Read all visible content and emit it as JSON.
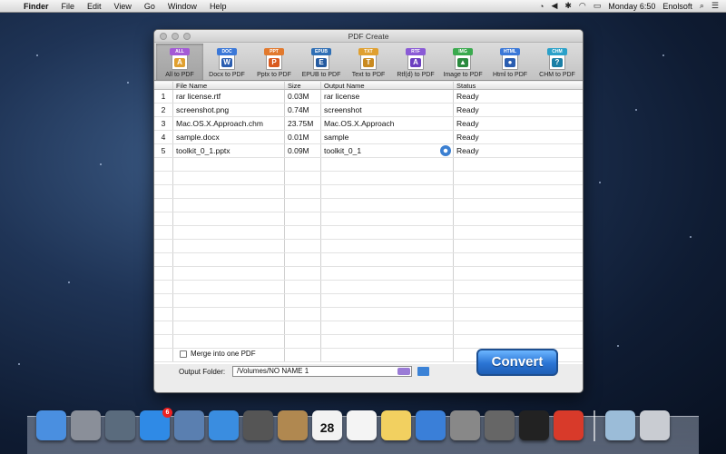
{
  "menubar": {
    "app": "Finder",
    "items": [
      "File",
      "Edit",
      "View",
      "Go",
      "Window",
      "Help"
    ],
    "clock": "Monday 6:50",
    "user": "Enolsoft"
  },
  "window": {
    "title": "PDF Create",
    "tools": [
      {
        "tag": "ALL",
        "label": "All to PDF",
        "tag_color": "#a45ad6",
        "sym_color": "#e0a030",
        "sym": "A"
      },
      {
        "tag": "DOC",
        "label": "Docx to PDF",
        "tag_color": "#3b78d8",
        "sym_color": "#2a5db0",
        "sym": "W"
      },
      {
        "tag": "PPT",
        "label": "Pptx to PDF",
        "tag_color": "#e2792d",
        "sym_color": "#d95a1e",
        "sym": "P"
      },
      {
        "tag": "EPUB",
        "label": "EPUB to PDF",
        "tag_color": "#2f6fb5",
        "sym_color": "#245aa0",
        "sym": "E"
      },
      {
        "tag": "TXT",
        "label": "Text to PDF",
        "tag_color": "#e0a030",
        "sym_color": "#c98a20",
        "sym": "T"
      },
      {
        "tag": "RTF",
        "label": "Rtf(d) to PDF",
        "tag_color": "#8a5ad6",
        "sym_color": "#6c3fc0",
        "sym": "A"
      },
      {
        "tag": "IMG",
        "label": "Image to PDF",
        "tag_color": "#3aaa4e",
        "sym_color": "#2a8a3e",
        "sym": "▲"
      },
      {
        "tag": "HTML",
        "label": "Html to PDF",
        "tag_color": "#3b78d8",
        "sym_color": "#2a5db0",
        "sym": "●"
      },
      {
        "tag": "CHM",
        "label": "CHM to PDF",
        "tag_color": "#2aa1c9",
        "sym_color": "#1a7fa6",
        "sym": "?"
      }
    ],
    "columns": [
      "",
      "File Name",
      "Size",
      "Output Name",
      "Status"
    ],
    "rows": [
      {
        "n": "1",
        "file": "rar license.rtf",
        "size": "0.03M",
        "out": "rar license",
        "status": "Ready"
      },
      {
        "n": "2",
        "file": "screenshot.png",
        "size": "0.74M",
        "out": "screenshot",
        "status": "Ready"
      },
      {
        "n": "3",
        "file": "Mac.OS.X.Approach.chm",
        "size": "23.75M",
        "out": "Mac.OS.X.Approach",
        "status": "Ready"
      },
      {
        "n": "4",
        "file": "sample.docx",
        "size": "0.01M",
        "out": "sample",
        "status": "Ready"
      },
      {
        "n": "5",
        "file": "toolkit_0_1.pptx",
        "size": "0.09M",
        "out": "toolkit_0_1",
        "status": "Ready"
      }
    ],
    "merge_label": "Merge into one PDF",
    "output_label": "Output Folder:",
    "output_value": "/Volumes/NO NAME 1",
    "convert_label": "Convert"
  },
  "dock": {
    "appstore_badge": "6",
    "calendar_day": "28",
    "icon_names": [
      "finder-icon",
      "launchpad-icon",
      "mission-control-icon",
      "app-store-icon",
      "mail-icon",
      "safari-icon",
      "facetime-icon",
      "contacts-icon",
      "calendar-icon",
      "reminders-icon",
      "notes-icon",
      "itunes-icon",
      "system-preferences-icon",
      "automator-icon",
      "terminal-icon",
      "pdf-app-icon"
    ]
  }
}
